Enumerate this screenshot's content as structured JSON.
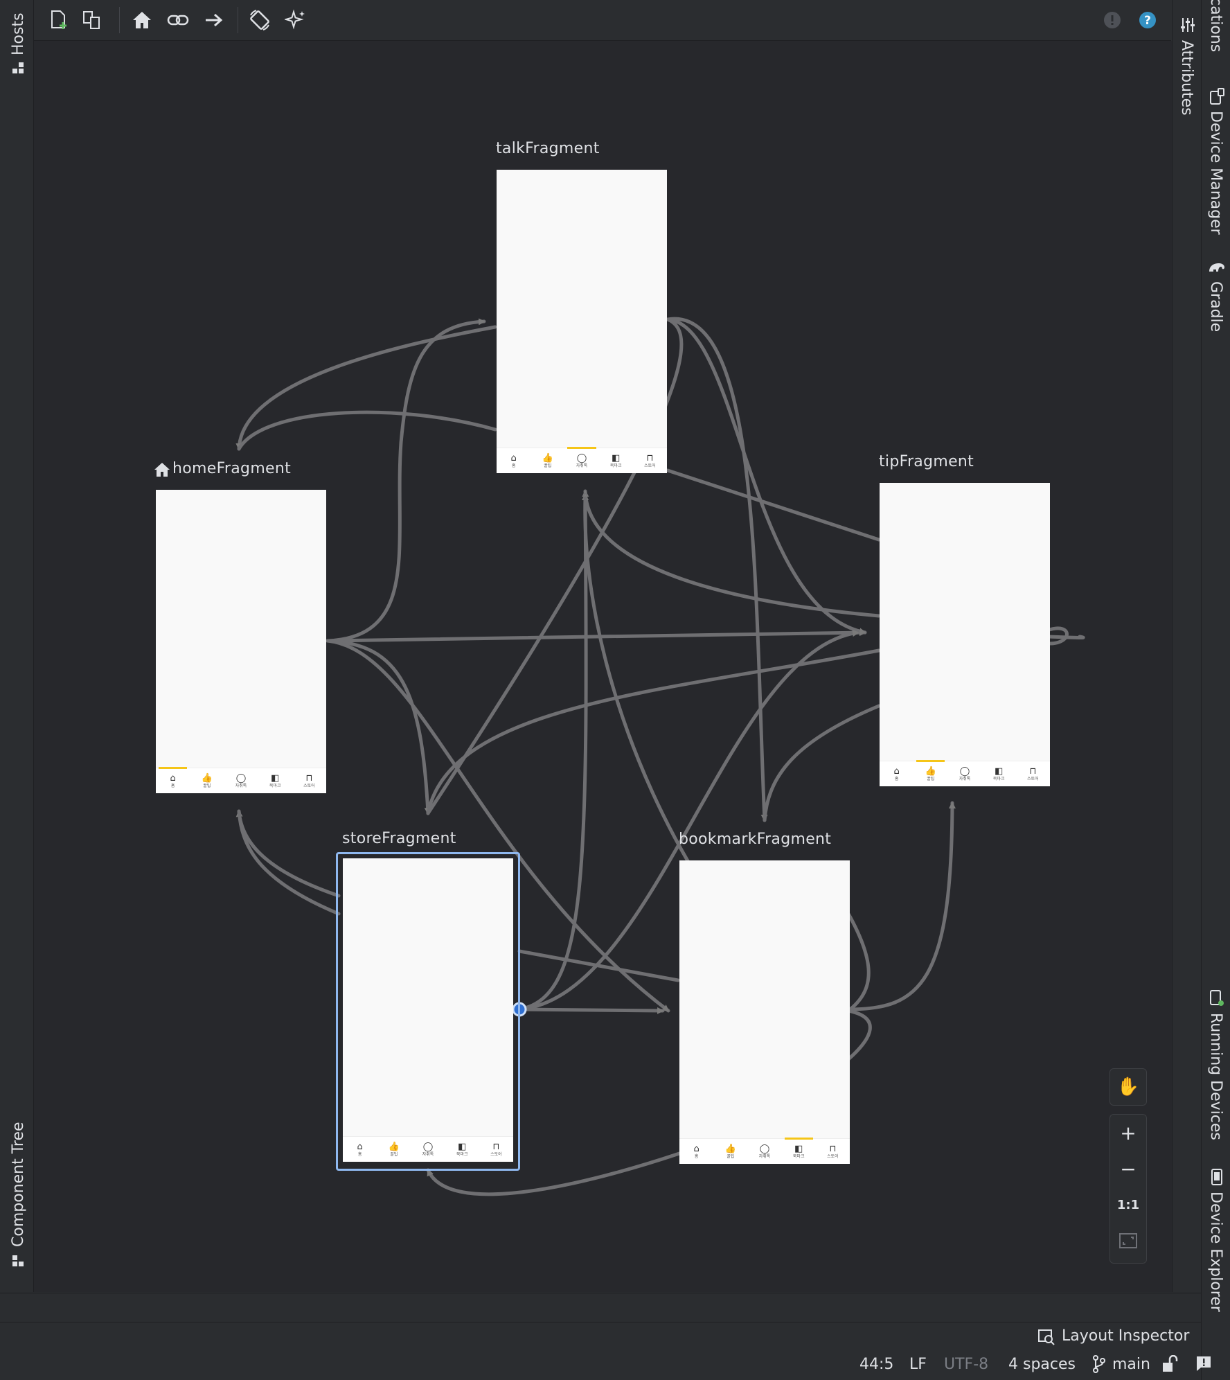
{
  "toolbar": {
    "buttons": [
      {
        "name": "new-destination-icon"
      },
      {
        "name": "nested-graph-icon"
      },
      {
        "name": "home-icon"
      },
      {
        "name": "deep-link-icon"
      },
      {
        "name": "action-arrow-icon"
      },
      {
        "name": "auto-arrange-icon"
      },
      {
        "name": "magic-icon"
      }
    ],
    "right": [
      {
        "name": "warning-icon"
      },
      {
        "name": "help-icon",
        "color": "#3592c4"
      }
    ]
  },
  "left_panel": {
    "hosts_label": "Hosts",
    "component_tree_label": "Component Tree"
  },
  "right_panel": {
    "attributes_label": "Attributes",
    "notifications_label": "cations",
    "device_manager_label": "Device Manager",
    "gradle_label": "Gradle",
    "running_devices_label": "Running Devices",
    "device_explorer_label": "Device Explorer"
  },
  "nav_graph": {
    "start_destination_icon": "home-icon",
    "edge_color": "#7a7a7a",
    "destinations": [
      {
        "id": "talk",
        "label": "talkFragment",
        "selected_tab": 2
      },
      {
        "id": "home",
        "label": "homeFragment",
        "start": true,
        "selected_tab": 0
      },
      {
        "id": "tip",
        "label": "tipFragment",
        "selected_tab": 1
      },
      {
        "id": "store",
        "label": "storeFragment",
        "selected": true,
        "selected_tab": -1
      },
      {
        "id": "bookmark",
        "label": "bookmarkFragment",
        "selected_tab": 3
      }
    ],
    "bottom_nav": [
      {
        "icon": "home-outline-icon",
        "glyph": "⌂",
        "label": "홈"
      },
      {
        "icon": "thumbs-up-icon",
        "glyph": "👍",
        "label": "꿀팁"
      },
      {
        "icon": "chat-bubble-icon",
        "glyph": "◯",
        "label": "자취톡"
      },
      {
        "icon": "book-icon",
        "glyph": "◧",
        "label": "북마크"
      },
      {
        "icon": "shopping-bag-icon",
        "glyph": "⊓",
        "label": "스토어"
      }
    ],
    "accent_color": "#f5c518",
    "selection_color": "#8fb8ef"
  },
  "zoom": {
    "pan_icon": "hand-icon",
    "zoom_in": "+",
    "zoom_out": "−",
    "actual_size": "1:1",
    "fit_icon": "fit-screen-icon"
  },
  "bottom": {
    "layout_inspector_label": "Layout Inspector"
  },
  "status": {
    "position": "44:5",
    "line_ending": "LF",
    "encoding": "UTF-8",
    "indent": "4 spaces",
    "branch": "main"
  }
}
